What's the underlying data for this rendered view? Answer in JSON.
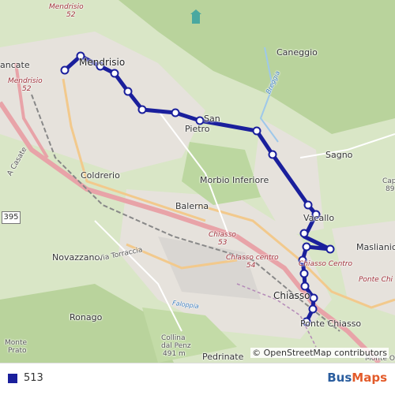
{
  "map": {
    "labels": {
      "mendrisio_top": "Mendrisio",
      "mendrisio_top_num": "52",
      "mendrisio_left": "Mendrisio",
      "mendrisio_left_num": "52",
      "mendrisio_center": "Mendrisio",
      "rancate": "ancate",
      "caneggio": "Caneggio",
      "breggia": "Breggia",
      "san_pietro_san": "San",
      "san_pietro": "Pietro",
      "sagno": "Sagno",
      "coldrerio": "Coldrerio",
      "morbio": "Morbio Inferiore",
      "balerna": "Balerna",
      "vacallo": "Vacallo",
      "maslianico": "Maslianico",
      "novazzano": "Novazzano",
      "via_torraccia": "Via Torraccia",
      "chiasso_road": "Chiasso",
      "chiasso_road_num": "53",
      "chiasso_centro": "Chiasso centro",
      "chiasso_centro_num": "54",
      "chiasso_centro_road": "Chiasso Centro",
      "chiasso": "Chiasso",
      "ponte_chiasso": "Ponte Chiasso",
      "ponte_chiasso_right": "Ponte Chi",
      "ronago": "Ronago",
      "monte_prato": "Monte",
      "monte_prato_2": "Prato",
      "collina": "Collina",
      "collina_2": "dal Penz",
      "collina_3": "491 m",
      "pedrinate": "Pedrinate",
      "monte_oli": "Monte Oli",
      "faloppia": "Faloppia",
      "casate": "A Casate",
      "cap": "Capc",
      "cap_num": "89",
      "shield_395": "395"
    },
    "attribution": "© OpenStreetMap contributors"
  },
  "route": {
    "color": "#1a1f9c"
  },
  "legend": {
    "route_label": "513",
    "brand_part1": "Bus",
    "brand_part2": "Maps",
    "swatch_color": "#1a1f9c"
  }
}
